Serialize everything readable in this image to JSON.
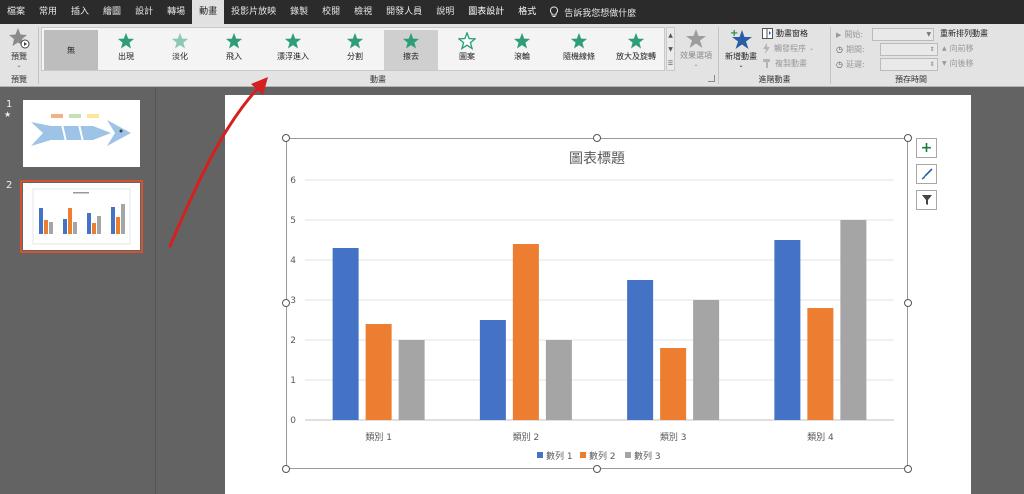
{
  "tabs": [
    "檔案",
    "常用",
    "插入",
    "繪圖",
    "設計",
    "轉場",
    "動畫",
    "投影片放映",
    "錄製",
    "校閱",
    "檢視",
    "開發人員",
    "說明",
    "圖表設計",
    "格式"
  ],
  "active_tab": "動畫",
  "tell_me": "告訴我您想做什麼",
  "ribbon": {
    "preview_label": "預覽",
    "preview_group": "預覽",
    "animation_group": "動畫",
    "advanced_group": "進階動畫",
    "timing_group": "預存時間",
    "animations": [
      "無",
      "出現",
      "淡化",
      "飛入",
      "漂浮進入",
      "分割",
      "擦去",
      "圖案",
      "滾輪",
      "隨機線條",
      "放大及旋轉"
    ],
    "effect_options": "效果選項",
    "add_animation": "新增動畫",
    "animation_pane": "動畫窗格",
    "trigger": "觸發程序",
    "animation_painter": "複製動畫",
    "start_label": "開始:",
    "duration_label": "期間:",
    "delay_label": "延遲:",
    "reorder_title": "重新排列動畫",
    "move_earlier": "向前移",
    "move_later": "向後移"
  },
  "slides": [
    {
      "number": "1",
      "star": "★"
    },
    {
      "number": "2"
    }
  ],
  "accent_colors": {
    "ribbon_bg": "#e3e3e3",
    "tabbar_bg": "#2b2b2b",
    "selected_slide": "#d35230",
    "annotation_arrow": "#d62020",
    "anim_green": "#2e9e79"
  },
  "chart_data": {
    "type": "bar",
    "title": "圖表標題",
    "categories": [
      "類別 1",
      "類別 2",
      "類別 3",
      "類別 4"
    ],
    "series": [
      {
        "name": "數列 1",
        "values": [
          4.3,
          2.5,
          3.5,
          4.5
        ],
        "color": "#4472c4"
      },
      {
        "name": "數列 2",
        "values": [
          2.4,
          4.4,
          1.8,
          2.8
        ],
        "color": "#ed7d31"
      },
      {
        "name": "數列 3",
        "values": [
          2,
          2,
          3,
          5
        ],
        "color": "#a5a5a5"
      }
    ],
    "ylim": [
      0,
      6
    ],
    "yticks": [
      0,
      1,
      2,
      3,
      4,
      5,
      6
    ],
    "grid": true,
    "legend": "bottom"
  }
}
